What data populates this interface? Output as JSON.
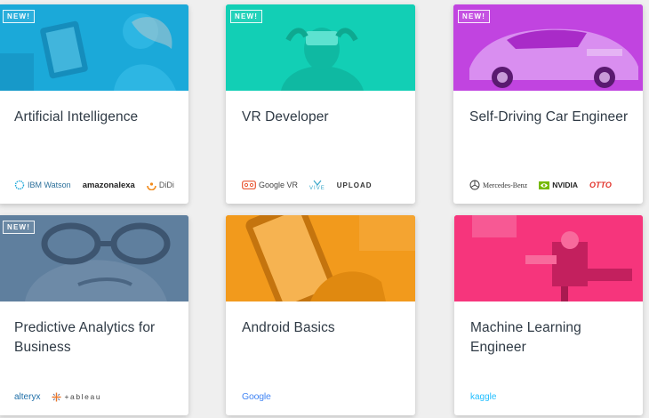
{
  "cards": [
    {
      "title": "Artificial Intelligence",
      "badge": "NEW!",
      "hero_color": "#1ba9d9",
      "partners": [
        "IBM Watson",
        "amazonalexa",
        "DiDi"
      ]
    },
    {
      "title": "VR Developer",
      "badge": "NEW!",
      "hero_color": "#12cfb5",
      "partners": [
        "Google VR",
        "VIVE",
        "UPLOAD"
      ]
    },
    {
      "title": "Self-Driving Car Engineer",
      "badge": "NEW!",
      "hero_color": "#c144e0",
      "partners": [
        "Mercedes-Benz",
        "NVIDIA",
        "OTTO"
      ]
    },
    {
      "title": "Predictive Analytics for Business",
      "badge": "NEW!",
      "hero_color": "#5f7f9e",
      "partners": [
        "alteryx",
        "+ableau"
      ]
    },
    {
      "title": "Android Basics",
      "badge": "",
      "hero_color": "#f29a1c",
      "partners": [
        "Google"
      ]
    },
    {
      "title": "Machine Learning Engineer",
      "badge": "",
      "hero_color": "#f6357c",
      "partners": [
        "kaggle"
      ]
    }
  ],
  "icons": {
    "ibm": "ibm-watson-logo-icon",
    "didi": "didi-logo-icon",
    "googlevr": "google-vr-logo-icon",
    "vive": "vive-logo-icon",
    "mercedes": "mercedes-star-icon",
    "nvidia": "nvidia-eye-icon",
    "tableau": "tableau-cross-icon"
  }
}
